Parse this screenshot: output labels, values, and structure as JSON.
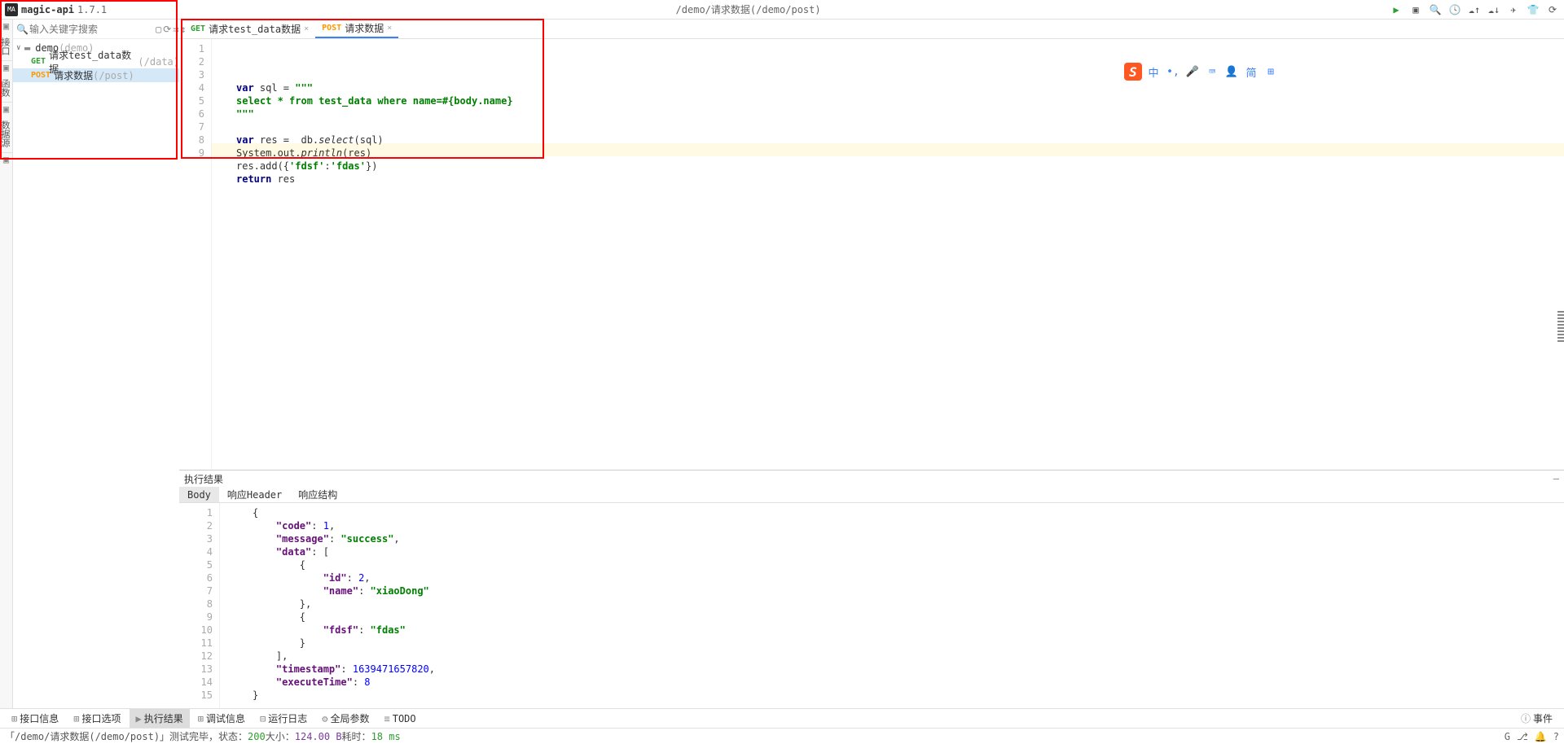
{
  "header": {
    "logo": "MA",
    "title": "magic-api",
    "version": "1.7.1",
    "path": "/demo/请求数据(/demo/post)"
  },
  "sidebar": {
    "search_placeholder": "输入关键字搜索",
    "left_tabs": [
      "接口",
      "函数",
      "数据源"
    ],
    "tree": {
      "root_name": "demo",
      "root_path": "(demo)",
      "children": [
        {
          "method": "GET",
          "name": "请求test_data数据",
          "path": "(/data)"
        },
        {
          "method": "POST",
          "name": "请求数据",
          "path": "(/post)"
        }
      ]
    }
  },
  "tabs": [
    {
      "method": "GET",
      "label": "请求test_data数据"
    },
    {
      "method": "POST",
      "label": "请求数据"
    }
  ],
  "editor": {
    "lines": [
      "1",
      "2",
      "3",
      "4",
      "5",
      "6",
      "7",
      "8",
      "9"
    ],
    "code_tokens": [
      [
        {
          "t": "kw",
          "v": "var"
        },
        {
          "t": "",
          "v": " sql = "
        },
        {
          "t": "str",
          "v": "\"\"\""
        }
      ],
      [
        {
          "t": "str",
          "v": "select * from test_data where name=#{body.name}"
        }
      ],
      [
        {
          "t": "str",
          "v": "\"\"\""
        }
      ],
      [],
      [
        {
          "t": "kw",
          "v": "var"
        },
        {
          "t": "",
          "v": " res =  db."
        },
        {
          "t": "fn",
          "v": "select"
        },
        {
          "t": "",
          "v": "(sql)"
        }
      ],
      [
        {
          "t": "",
          "v": "System.out."
        },
        {
          "t": "fn",
          "v": "println"
        },
        {
          "t": "",
          "v": "(res)"
        }
      ],
      [
        {
          "t": "",
          "v": "res.add({"
        },
        {
          "t": "str",
          "v": "'fdsf'"
        },
        {
          "t": "",
          "v": ":"
        },
        {
          "t": "str",
          "v": "'fdas'"
        },
        {
          "t": "",
          "v": "})"
        }
      ],
      [
        {
          "t": "kw",
          "v": "return"
        },
        {
          "t": "",
          "v": " res"
        }
      ],
      []
    ]
  },
  "bottom": {
    "title": "执行结果",
    "tabs": [
      "Body",
      "响应Header",
      "响应结构"
    ],
    "lines": [
      "1",
      "2",
      "3",
      "4",
      "5",
      "6",
      "7",
      "8",
      "9",
      "10",
      "11",
      "12",
      "13",
      "14",
      "15"
    ],
    "json_tokens": [
      [
        {
          "t": "",
          "v": "{"
        }
      ],
      [
        {
          "t": "",
          "v": "    "
        },
        {
          "t": "jk",
          "v": "\"code\""
        },
        {
          "t": "",
          "v": ": "
        },
        {
          "t": "jn",
          "v": "1"
        },
        {
          "t": "",
          "v": ","
        }
      ],
      [
        {
          "t": "",
          "v": "    "
        },
        {
          "t": "jk",
          "v": "\"message\""
        },
        {
          "t": "",
          "v": ": "
        },
        {
          "t": "js",
          "v": "\"success\""
        },
        {
          "t": "",
          "v": ","
        }
      ],
      [
        {
          "t": "",
          "v": "    "
        },
        {
          "t": "jk",
          "v": "\"data\""
        },
        {
          "t": "",
          "v": ": ["
        }
      ],
      [
        {
          "t": "",
          "v": "        {"
        }
      ],
      [
        {
          "t": "",
          "v": "            "
        },
        {
          "t": "jk",
          "v": "\"id\""
        },
        {
          "t": "",
          "v": ": "
        },
        {
          "t": "jn",
          "v": "2"
        },
        {
          "t": "",
          "v": ","
        }
      ],
      [
        {
          "t": "",
          "v": "            "
        },
        {
          "t": "jk",
          "v": "\"name\""
        },
        {
          "t": "",
          "v": ": "
        },
        {
          "t": "js",
          "v": "\"xiaoDong\""
        }
      ],
      [
        {
          "t": "",
          "v": "        },"
        }
      ],
      [
        {
          "t": "",
          "v": "        {"
        }
      ],
      [
        {
          "t": "",
          "v": "            "
        },
        {
          "t": "jk",
          "v": "\"fdsf\""
        },
        {
          "t": "",
          "v": ": "
        },
        {
          "t": "js",
          "v": "\"fdas\""
        }
      ],
      [
        {
          "t": "",
          "v": "        }"
        }
      ],
      [
        {
          "t": "",
          "v": "    ],"
        }
      ],
      [
        {
          "t": "",
          "v": "    "
        },
        {
          "t": "jk",
          "v": "\"timestamp\""
        },
        {
          "t": "",
          "v": ": "
        },
        {
          "t": "jn",
          "v": "1639471657820"
        },
        {
          "t": "",
          "v": ","
        }
      ],
      [
        {
          "t": "",
          "v": "    "
        },
        {
          "t": "jk",
          "v": "\"executeTime\""
        },
        {
          "t": "",
          "v": ": "
        },
        {
          "t": "jn",
          "v": "8"
        }
      ],
      [
        {
          "t": "",
          "v": "}"
        }
      ]
    ]
  },
  "footer1": {
    "items": [
      "接口信息",
      "接口选项",
      "执行结果",
      "调试信息",
      "运行日志",
      "全局参数",
      "TODO"
    ],
    "events": "事件"
  },
  "footer2": {
    "p1": "「/demo/请求数据(/demo/post)」测试完毕，状态：",
    "status": "200",
    "p2": " 大小：",
    "size": "124.00 B",
    "p3": " 耗时：",
    "time": "18 ms"
  },
  "ime_items": [
    "中",
    "•,",
    "🎤",
    "⌨",
    "👤",
    "简",
    "⊞"
  ]
}
